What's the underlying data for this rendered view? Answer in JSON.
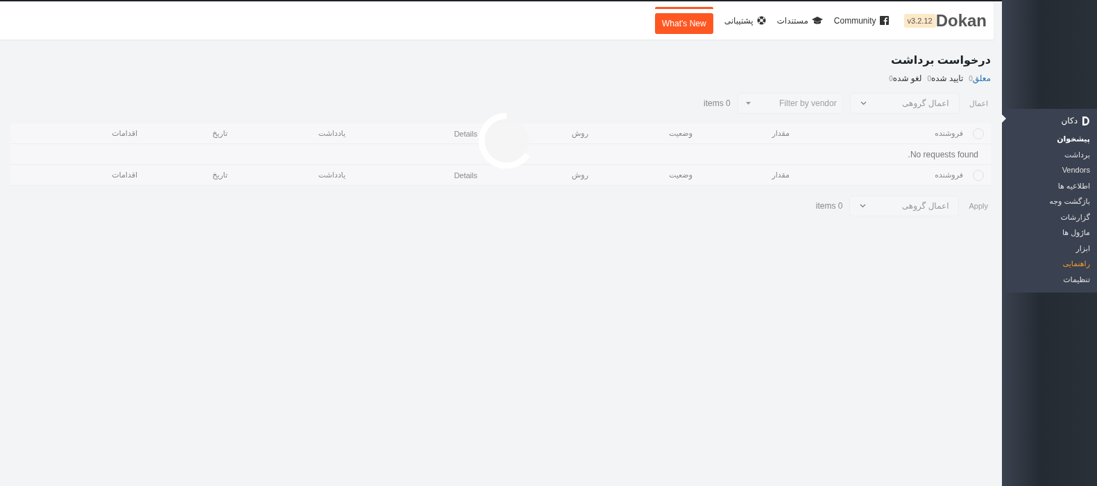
{
  "header": {
    "logo": "Dokan",
    "version": "v3.2.12",
    "links": [
      {
        "label": "Community",
        "kind": "facebook"
      },
      {
        "label": "مستندات",
        "kind": "docs"
      },
      {
        "label": "پشتیبانی",
        "kind": "support"
      }
    ],
    "whats_new": "What's New"
  },
  "page_title": "درخواست برداشت",
  "status_tabs": [
    {
      "label": "معلق",
      "count": "0",
      "selected": true
    },
    {
      "label": "تایید شده",
      "count": "0",
      "selected": false
    },
    {
      "label": "لغو شده",
      "count": "0",
      "selected": false
    }
  ],
  "top_actions": {
    "apply": "اعمال",
    "apply_disabled": true,
    "bulk_select": "اعمال گروهی",
    "vendor_filter_placeholder": "Filter by vendor",
    "items": "items 0"
  },
  "table": {
    "header_checked": false,
    "columns": [
      "فروشنده",
      "مقدار",
      "وضعیت",
      "روش",
      "Details",
      "یادداشت",
      "تاریخ",
      "اقدامات"
    ],
    "empty_message": "No requests found.",
    "footer_checked": false,
    "footer_columns": [
      "فروشنده",
      "مقدار",
      "وضعیت",
      "روش",
      "Details",
      "یادداشت",
      "تاریخ",
      "اقدامات"
    ],
    "loading": true
  },
  "bottom_actions": {
    "apply": "Apply",
    "apply_disabled": true,
    "bulk_select": "اعمال گروهی",
    "items": "items 0"
  },
  "sidebar": {
    "menu_title": "دکان",
    "items": [
      {
        "label": "پیشخوان",
        "selected": true,
        "highlighted": false
      },
      {
        "label": "برداشت",
        "selected": false,
        "highlighted": false
      },
      {
        "label": "Vendors",
        "selected": false,
        "highlighted": false
      },
      {
        "label": "اطلاعیه ها",
        "selected": false,
        "highlighted": false
      },
      {
        "label": "بازگشت وجه",
        "selected": false,
        "highlighted": false
      },
      {
        "label": "گزارشات",
        "selected": false,
        "highlighted": false
      },
      {
        "label": "ماژول ها",
        "selected": false,
        "highlighted": false
      },
      {
        "label": "ابزار",
        "selected": false,
        "highlighted": false
      },
      {
        "label": "راهنمایی",
        "selected": false,
        "highlighted": true
      },
      {
        "label": "تنظیمات",
        "selected": false,
        "highlighted": false
      }
    ]
  }
}
